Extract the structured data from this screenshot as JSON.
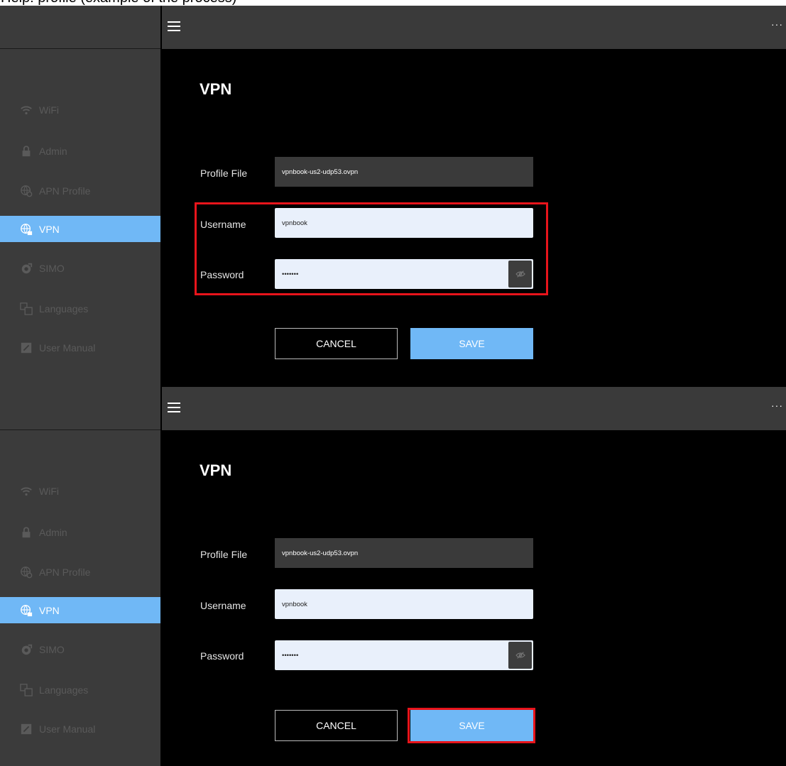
{
  "caption": "Help: profile (example of the process)",
  "colors": {
    "accent": "#70b8f6",
    "highlight": "#e8141b",
    "sidebar": "#3b3b3b",
    "topbar": "#3a3a3a"
  },
  "topbar": {
    "menu_icon": "hamburger-icon",
    "more_label": "···"
  },
  "nav": [
    {
      "label": "WiFi",
      "icon": "wifi-icon"
    },
    {
      "label": "Admin",
      "icon": "lock-icon"
    },
    {
      "label": "APN Profile",
      "icon": "globe-gear-icon"
    },
    {
      "label": "VPN",
      "icon": "globe-lock-icon",
      "active": true
    },
    {
      "label": "SIMO",
      "icon": "simo-icon"
    },
    {
      "label": "Languages",
      "icon": "translate-icon"
    },
    {
      "label": "User Manual",
      "icon": "book-icon"
    }
  ],
  "page": {
    "title": "VPN",
    "profile_label": "Profile File",
    "profile_value": "vpnbook-us2-udp53.ovpn",
    "username_label": "Username",
    "username_value": "vpnbook",
    "password_label": "Password",
    "password_value": "•••••••",
    "cancel_label": "CANCEL",
    "save_label": "SAVE"
  },
  "steps": [
    {
      "highlighted": "credentials-fields"
    },
    {
      "highlighted": "save-button"
    }
  ]
}
